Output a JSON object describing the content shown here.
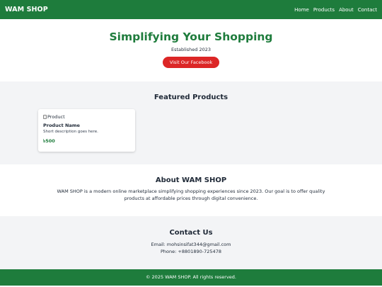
{
  "navbar": {
    "brand": "WAM SHOP",
    "links": [
      "Home",
      "Products",
      "About",
      "Contact"
    ]
  },
  "hero": {
    "title": "Simplifying Your Shopping",
    "subtitle": "Established 2023",
    "button_label": "Visit Our Facebook"
  },
  "featured": {
    "title": "Featured Products",
    "products": [
      {
        "image_alt": "Product",
        "name": "Product Name",
        "description": "Short description goes here.",
        "price": "৳500"
      }
    ]
  },
  "about": {
    "title": "About WAM SHOP",
    "text": "WAM SHOP is a modern online marketplace simplifying shopping experiences since 2023. Our goal is to offer quality products at affordable prices through digital convenience."
  },
  "contact": {
    "title": "Contact Us",
    "email": "Email: mohsinsifat344@gmail.com",
    "phone": "Phone: +8801890-725478"
  },
  "footer": {
    "text": "© 2025 WAM SHOP. All rights reserved."
  },
  "colors": {
    "brand_green": "#1e7c3c",
    "button_red": "#dc2626",
    "section_gray": "#f3f4f6"
  }
}
